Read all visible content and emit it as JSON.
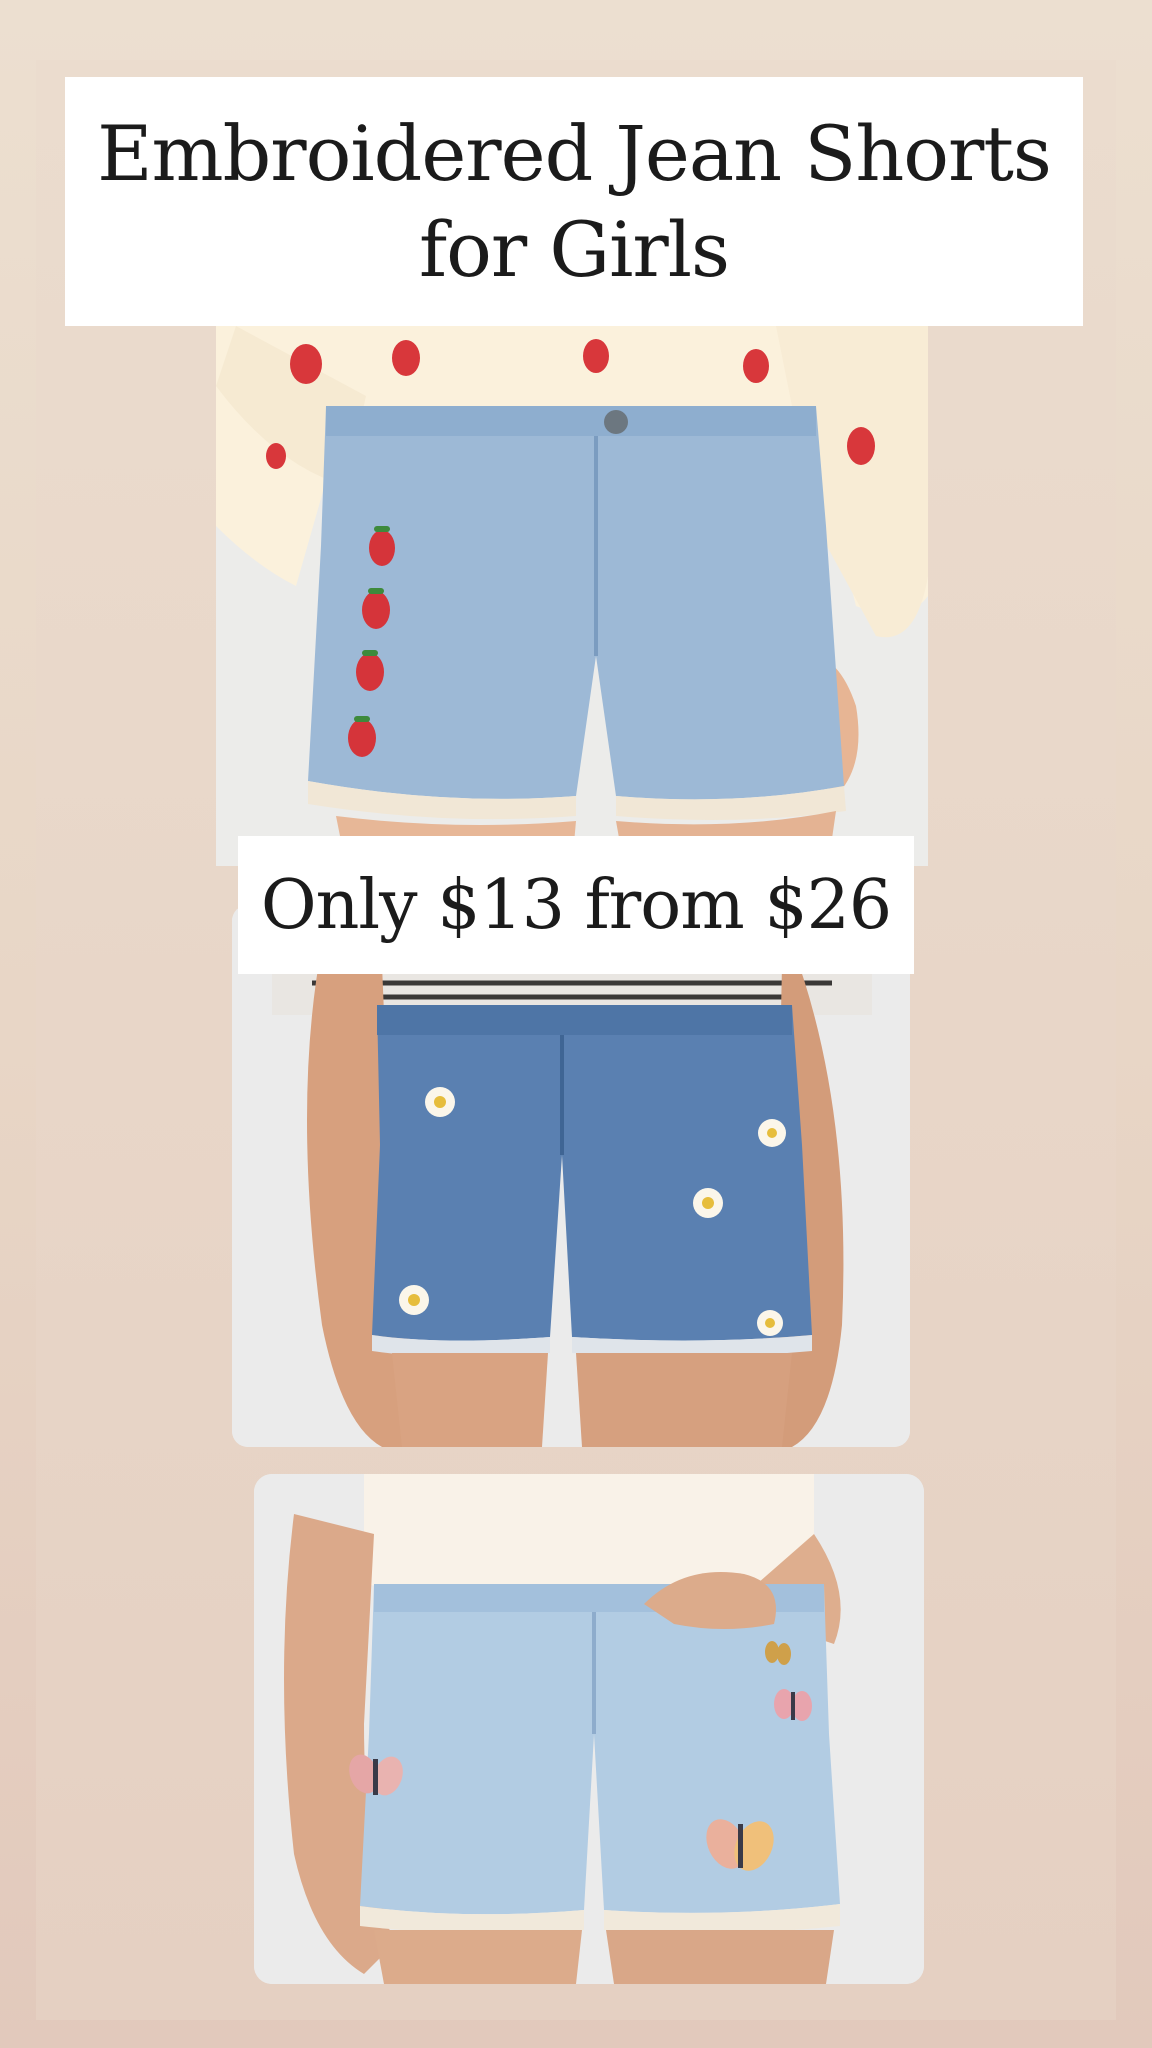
{
  "title": {
    "line1": "Embroidered Jean Shorts",
    "line2": "for Girls"
  },
  "price": {
    "text": "Only $13 from $26"
  },
  "photos": [
    {
      "name": "strawberry-embroidered-shorts",
      "denim": "#9cb8d6",
      "motif": "strawberry"
    },
    {
      "name": "daisy-embroidered-shorts",
      "denim": "#5a80b0",
      "motif": "daisy"
    },
    {
      "name": "butterfly-embroidered-shorts",
      "denim": "#b3cde3",
      "motif": "butterfly"
    }
  ],
  "colors": {
    "background": "#e8d6c6",
    "card": "#ffffff",
    "text": "#1b1b1b"
  }
}
